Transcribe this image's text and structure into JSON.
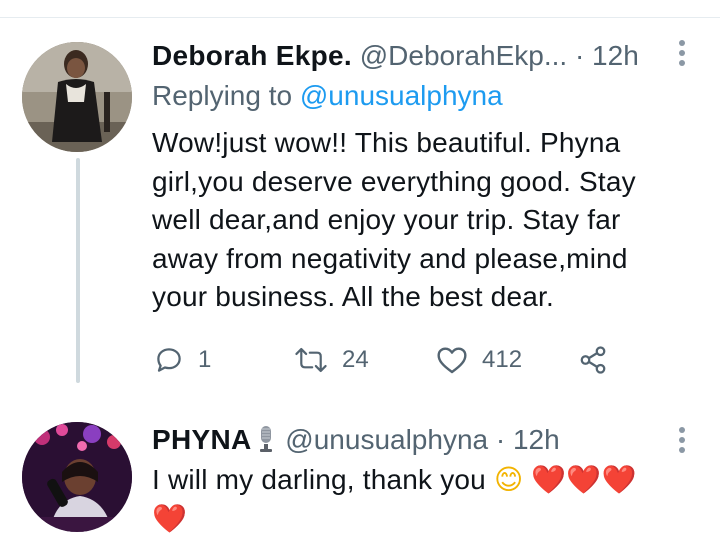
{
  "tweets": [
    {
      "author_name": "Deborah Ekpe.",
      "handle": "@DeborahEkp...",
      "time": "· 12h",
      "replying_prefix": "Replying to",
      "replying_handle": "@unusualphyna",
      "text": "Wow!just wow!! This beautiful. Phyna girl,you deserve everything good. Stay well dear,and enjoy your trip. Stay far away from negativity and please,mind your business. All the best dear.",
      "replies": "1",
      "retweets": "24",
      "likes": "412"
    },
    {
      "author_name": "PHYNA",
      "handle": "@unusualphyna",
      "time": "· 12h",
      "text": "I will my darling, thank you",
      "emoji_smile": "😊",
      "emoji_hearts": "❤️❤️❤️",
      "emoji_heart_last": "❤️"
    }
  ],
  "icons": {
    "reply": "reply-icon",
    "retweet": "retweet-icon",
    "like": "like-icon",
    "share": "share-icon",
    "more": "more-icon",
    "mic": "microphone-icon"
  },
  "colors": {
    "link": "#1d9bf0",
    "secondary_text": "#536471",
    "heart": "#e0245e"
  }
}
